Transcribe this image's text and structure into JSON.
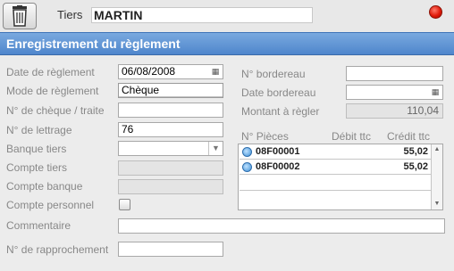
{
  "header": {
    "tiers_label": "Tiers",
    "tiers_value": "MARTIN"
  },
  "title": "Enregistrement du règlement",
  "form": {
    "date_reglement": {
      "label": "Date de règlement",
      "value": "06/08/2008"
    },
    "mode_reglement": {
      "label": "Mode de règlement",
      "value": "Chèque"
    },
    "num_cheque": {
      "label": "N° de chèque / traite",
      "value": ""
    },
    "num_lettrage": {
      "label": "N° de lettrage",
      "value": "76"
    },
    "banque_tiers": {
      "label": "Banque tiers",
      "value": ""
    },
    "compte_tiers": {
      "label": "Compte tiers",
      "value": ""
    },
    "compte_banque": {
      "label": "Compte banque",
      "value": ""
    },
    "compte_personnel": {
      "label": "Compte personnel",
      "checked": false
    },
    "commentaire": {
      "label": "Commentaire",
      "value": ""
    },
    "num_rapprochement": {
      "label": "N° de rapprochement",
      "value": ""
    },
    "num_bordereau": {
      "label": "N° bordereau",
      "value": ""
    },
    "date_bordereau": {
      "label": "Date bordereau",
      "value": ""
    },
    "montant": {
      "label": "Montant à règler",
      "value": "110,04"
    }
  },
  "pieces": {
    "headers": {
      "name": "N° Pièces",
      "debit": "Débit ttc",
      "credit": "Crédit ttc"
    },
    "rows": [
      {
        "name": "08F00001",
        "debit": "",
        "credit": "55,02"
      },
      {
        "name": "08F00002",
        "debit": "",
        "credit": "55,02"
      }
    ]
  },
  "colors": {
    "title_bar": "#4f86cc",
    "close_button": "#e01a0a"
  }
}
